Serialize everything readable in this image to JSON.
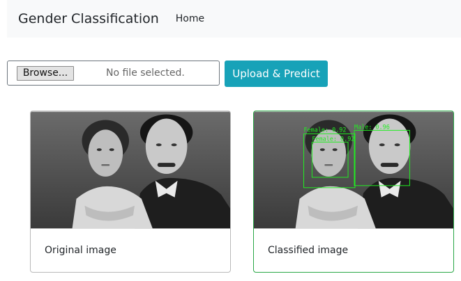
{
  "navbar": {
    "brand": "Gender Classification",
    "home": "Home"
  },
  "upload_form": {
    "browse_label": "Browse...",
    "file_status": "No file selected.",
    "submit_label": "Upload & Predict"
  },
  "cards": [
    {
      "caption": "Original image"
    },
    {
      "caption": "Classified image",
      "detections": [
        {
          "label": "Female: 0.92"
        },
        {
          "label": "Female: 0.92"
        },
        {
          "label": "Male: 0.96"
        }
      ]
    }
  ],
  "colors": {
    "accent": "#17a2b8",
    "detection_box": "#22ee22",
    "card_success_border": "#28a745"
  }
}
